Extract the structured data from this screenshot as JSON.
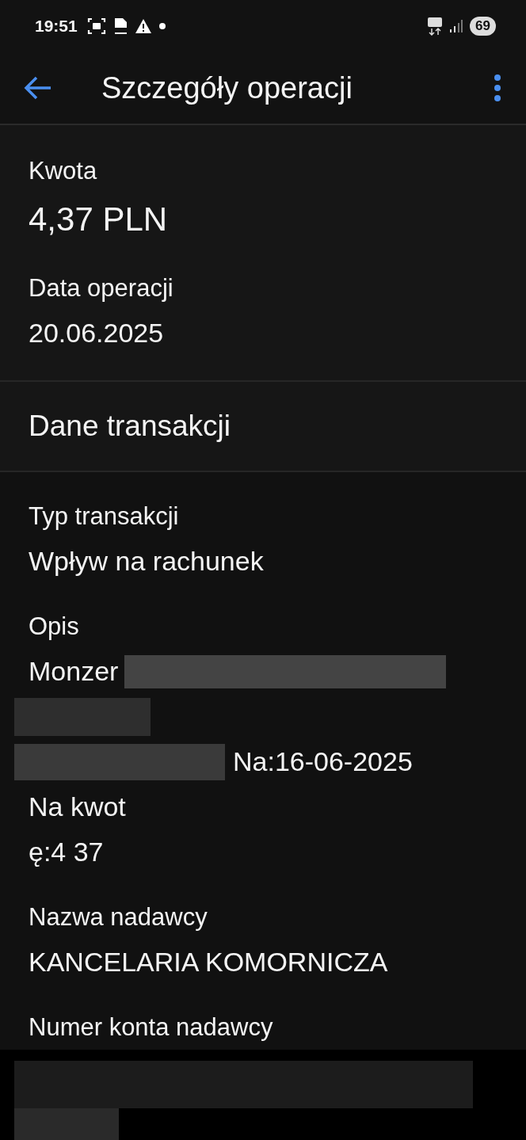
{
  "status_bar": {
    "time": "19:51",
    "battery": "69"
  },
  "header": {
    "title": "Szczegóły operacji"
  },
  "summary": [
    {
      "label": "Kwota",
      "value": "4,37 PLN",
      "kind": "amount"
    },
    {
      "label": "Data operacji",
      "value": "20.06.2025",
      "kind": "plain"
    }
  ],
  "section_title": "Dane transakcji",
  "fields": [
    {
      "label": "Typ transakcji",
      "lines": [
        {
          "kind": "text",
          "text": "Wpływ na rachunek"
        }
      ]
    },
    {
      "label": "Opis",
      "lines": [
        {
          "kind": "text_redacted",
          "text": "Monzer"
        },
        {
          "kind": "redacted"
        },
        {
          "kind": "redacted_text",
          "text": "Na:16-06-2025"
        },
        {
          "kind": "text",
          "text": "Na kwot"
        },
        {
          "kind": "text",
          "text": "ę:4 37"
        }
      ]
    },
    {
      "label": "Nazwa nadawcy",
      "lines": [
        {
          "kind": "text",
          "text": "KANCELARIA KOMORNICZA"
        }
      ]
    },
    {
      "label": "Numer konta nadawcy",
      "lines": [
        {
          "kind": "redacted_account"
        }
      ]
    }
  ]
}
